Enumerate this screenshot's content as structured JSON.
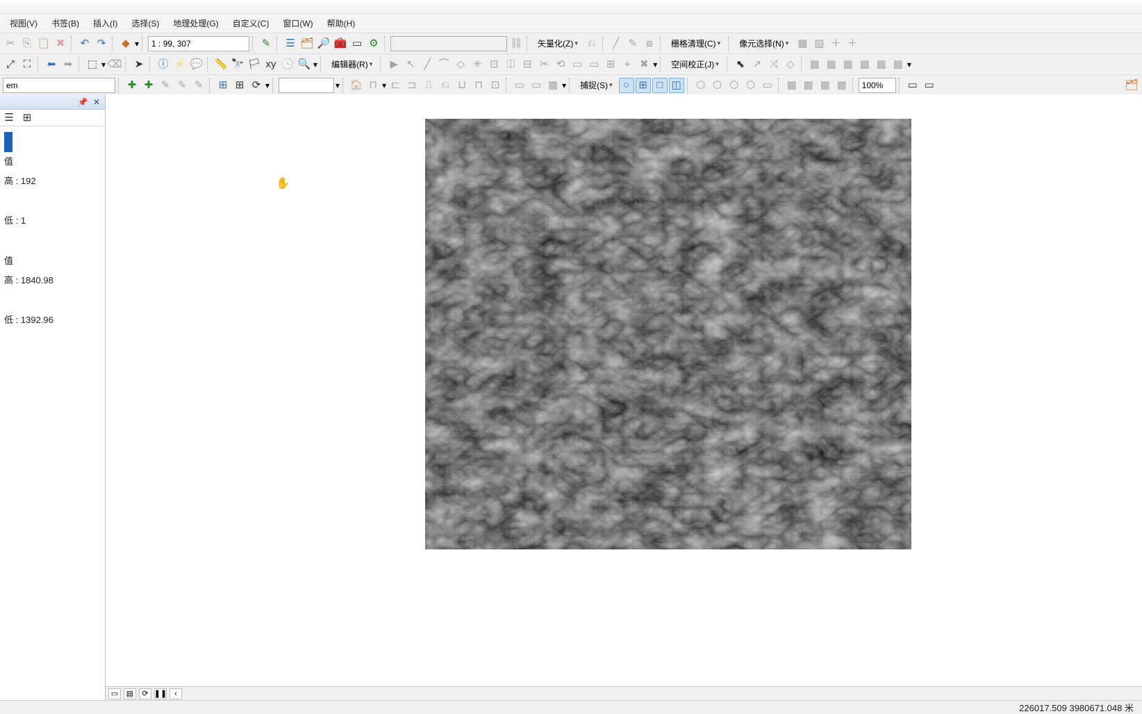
{
  "menus": {
    "view": "视图(V)",
    "bookmark": "书签(B)",
    "insert": "插入(I)",
    "select": "选择(S)",
    "geoprocessing": "地理处理(G)",
    "customize": "自定义(C)",
    "window": "窗口(W)",
    "help": "帮助(H)"
  },
  "toolbar1": {
    "scale_value": "1 : 99, 307",
    "vectorize": "矢量化(Z)",
    "raster_cleanup": "栅格清理(C)",
    "cell_select": "像元选择(N)"
  },
  "toolbar2": {
    "editor": "编辑器(R)",
    "spatial_adjust": "空间校正(J)"
  },
  "toolbar3": {
    "snap": "捕捉(S)",
    "zoom_pct": "100%",
    "layer_combo": "em"
  },
  "toc": {
    "line_val1": "192",
    "line_val2": "1",
    "line_val3": "1840.98",
    "line_val4": "1392.96",
    "label_hi": "高 :",
    "label_lo": "低 :",
    "label_val": "值"
  },
  "status": {
    "coords": "226017.509  3980671.048 米"
  },
  "viewtabs": {
    "data": "▭",
    "layout": "▤",
    "refresh": "⟳",
    "pause": "❚❚",
    "back": "‹"
  }
}
